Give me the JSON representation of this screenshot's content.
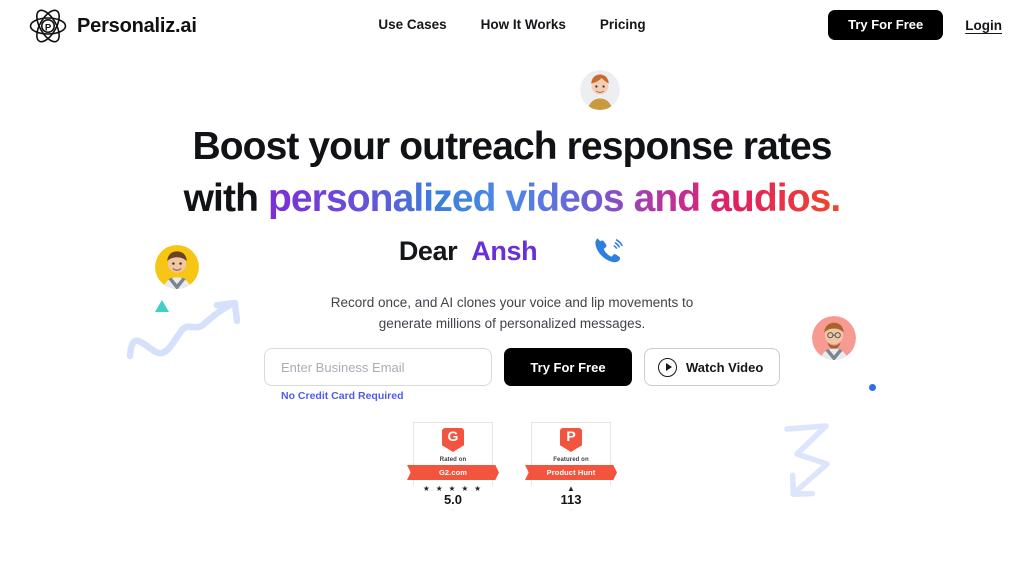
{
  "header": {
    "brand_name": "Personaliz.ai",
    "logo_letter": "P",
    "logo_icon": "atom-icon",
    "nav": [
      {
        "label": "Use Cases"
      },
      {
        "label": "How It Works"
      },
      {
        "label": "Pricing"
      }
    ],
    "cta_label": "Try For Free",
    "login_label": "Login"
  },
  "hero": {
    "headline_line1": "Boost your outreach response rates",
    "headline_line2_prefix": "with ",
    "headline_line2_gradient": "personalized videos and audios.",
    "dear_label": "Dear",
    "dear_name": "Ansh",
    "phone_icon": "ringing-phone-icon",
    "subcopy_line1": "Record once, and AI clones your voice and lip movements to",
    "subcopy_line2": "generate millions of personalized messages.",
    "email_placeholder": "Enter Business Email",
    "email_value": "",
    "no_credit_card": "No Credit Card Required",
    "try_label": "Try For Free",
    "watch_label": "Watch Video",
    "watch_icon": "play-icon"
  },
  "badges": [
    {
      "logo_letter": "G",
      "sub_label": "Rated on",
      "ribbon_label": "G2.com",
      "stars": "★ ★ ★ ★ ★",
      "score": "5.0"
    },
    {
      "logo_letter": "P",
      "sub_label": "Featured on",
      "ribbon_label": "Product Hunt",
      "arrow": "▲",
      "score": "113"
    }
  ],
  "decor": {
    "avatar_top": "avatar-woman",
    "avatar_left": "avatar-man-yellow",
    "avatar_right": "avatar-man-pink",
    "dot_yellow_color": "#f5c518",
    "dot_blue_color": "#2f6fe0",
    "triangle_color": "#3fd0c2",
    "squiggle_color": "#d5e0fb",
    "zigzag_color": "#dce5fc"
  },
  "colors": {
    "accent_purple": "#6a30d8",
    "accent_blue": "#4f5bf0",
    "badge_red": "#f2543d",
    "black": "#000000"
  }
}
